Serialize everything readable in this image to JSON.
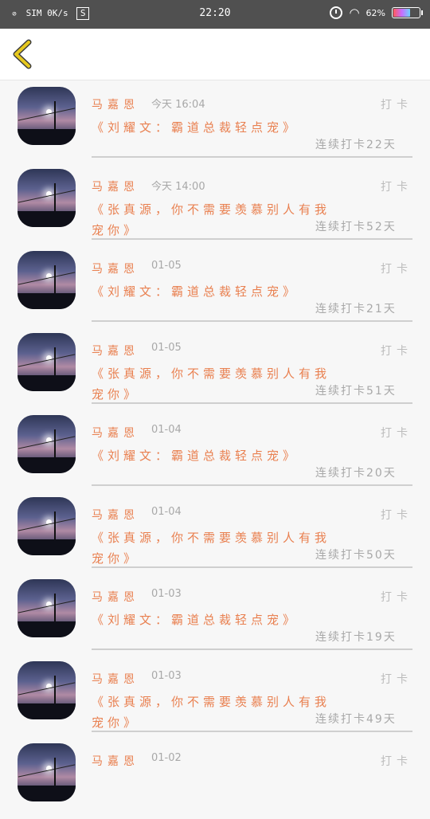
{
  "status_bar": {
    "left_text": "SIM 0K/s",
    "sim_icon": "sim-icon",
    "app_icon_letter": "S",
    "time": "22:20",
    "battery_text": "62%",
    "battery_level": 0.62
  },
  "header": {
    "back_icon": "chevron-left-icon",
    "accent_color": "#e6c81e"
  },
  "colors": {
    "orange": "#e98050",
    "gray": "#a8a8a8"
  },
  "items": [
    {
      "name": "马嘉恩",
      "time": "今天 16:04",
      "title": "《刘耀文：霸道总裁轻点宠》",
      "daka": "打卡",
      "streak": "连续打卡22天"
    },
    {
      "name": "马嘉恩",
      "time": "今天 14:00",
      "title": "《张真源，你不需要羡慕别人有我宠你》",
      "daka": "打卡",
      "streak": "连续打卡52天"
    },
    {
      "name": "马嘉恩",
      "time": "01-05",
      "title": "《刘耀文：霸道总裁轻点宠》",
      "daka": "打卡",
      "streak": "连续打卡21天"
    },
    {
      "name": "马嘉恩",
      "time": "01-05",
      "title": "《张真源，你不需要羡慕别人有我宠你》",
      "daka": "打卡",
      "streak": "连续打卡51天"
    },
    {
      "name": "马嘉恩",
      "time": "01-04",
      "title": "《刘耀文：霸道总裁轻点宠》",
      "daka": "打卡",
      "streak": "连续打卡20天"
    },
    {
      "name": "马嘉恩",
      "time": "01-04",
      "title": "《张真源，你不需要羡慕别人有我宠你》",
      "daka": "打卡",
      "streak": "连续打卡50天"
    },
    {
      "name": "马嘉恩",
      "time": "01-03",
      "title": "《刘耀文：霸道总裁轻点宠》",
      "daka": "打卡",
      "streak": "连续打卡19天"
    },
    {
      "name": "马嘉恩",
      "time": "01-03",
      "title": "《张真源，你不需要羡慕别人有我宠你》",
      "daka": "打卡",
      "streak": "连续打卡49天"
    },
    {
      "name": "马嘉恩",
      "time": "01-02",
      "title": "",
      "daka": "打卡",
      "streak": ""
    }
  ]
}
